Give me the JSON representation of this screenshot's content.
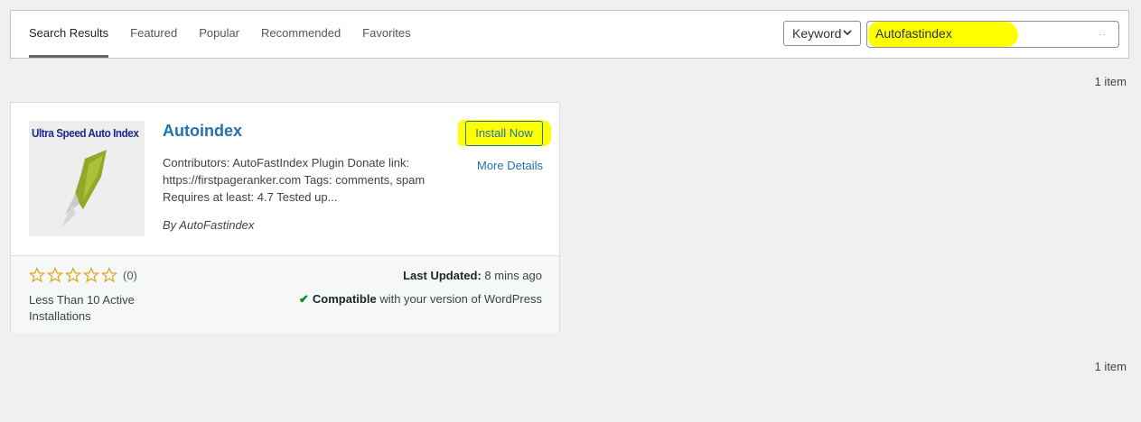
{
  "tabs": [
    {
      "label": "Search Results",
      "active": true
    },
    {
      "label": "Featured",
      "active": false
    },
    {
      "label": "Popular",
      "active": false
    },
    {
      "label": "Recommended",
      "active": false
    },
    {
      "label": "Favorites",
      "active": false
    }
  ],
  "search": {
    "type_selected": "Keyword",
    "value": "Autofastindex",
    "highlight_color": "#ffff00"
  },
  "count_top": "1 item",
  "count_bottom": "1 item",
  "plugin": {
    "thumbnail_text": "Ultra Speed Auto Index",
    "name": "Autoindex",
    "description": "Contributors: AutoFastIndex Plugin Donate link: https://firstpageranker.com Tags: comments, spam Requires at least: 4.7 Tested up...",
    "author": "By AutoFastindex",
    "install_label": "Install Now",
    "more_details_label": "More Details",
    "rating_stars": 0,
    "rating_count": "(0)",
    "installs": "Less Than 10 Active Installations",
    "last_updated_label": "Last Updated:",
    "last_updated_value": "8 mins ago",
    "compatible_label": "Compatible",
    "compatible_text": "with your version of WordPress"
  },
  "colors": {
    "accent": "#2271b1",
    "highlight": "#ffff00",
    "compatible": "#008a20",
    "star": "#dba617"
  }
}
